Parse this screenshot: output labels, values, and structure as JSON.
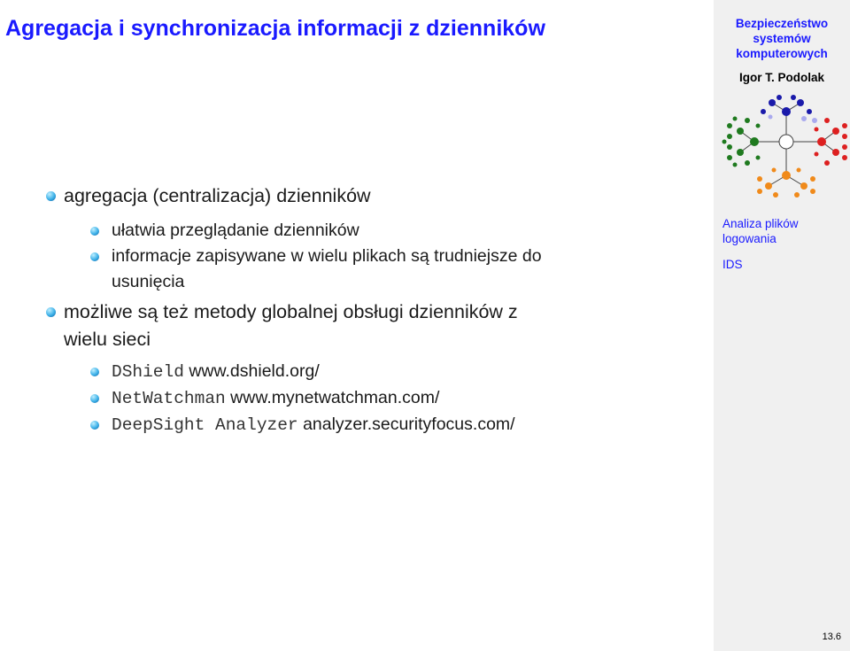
{
  "title": "Agregacja i synchronizacja informacji z dzienników",
  "sidebar": {
    "course": [
      "Bezpieczeństwo",
      "systemów",
      "komputerowych"
    ],
    "author": "Igor T. Podolak",
    "nav": [
      {
        "label": "Analiza plików",
        "label2": "logowania"
      },
      {
        "label": "IDS"
      }
    ],
    "page_number": "13.6",
    "logo_icon": "network-tree-icon",
    "colors": {
      "accent": "#1a1aff",
      "sidebar_bg": "#f0f0f0"
    }
  },
  "items": [
    {
      "text": "agregacja (centralizacja) dzienników",
      "subitems": [
        {
          "text": "ułatwia przeglądanie dzienników"
        },
        {
          "text": "informacje zapisywane w wielu plikach są trudniejsze do",
          "text2": "usunięcia"
        }
      ]
    },
    {
      "text": "możliwe są też metody globalnej obsługi dzienników z",
      "text2": "wielu sieci",
      "subitems": [
        {
          "code": "DShield",
          "url": "www.dshield.org/"
        },
        {
          "code": "NetWatchman",
          "url": "www.mynetwatchman.com/"
        },
        {
          "code": "DeepSight Analyzer",
          "url": "analyzer.securityfocus.com/"
        }
      ]
    }
  ]
}
